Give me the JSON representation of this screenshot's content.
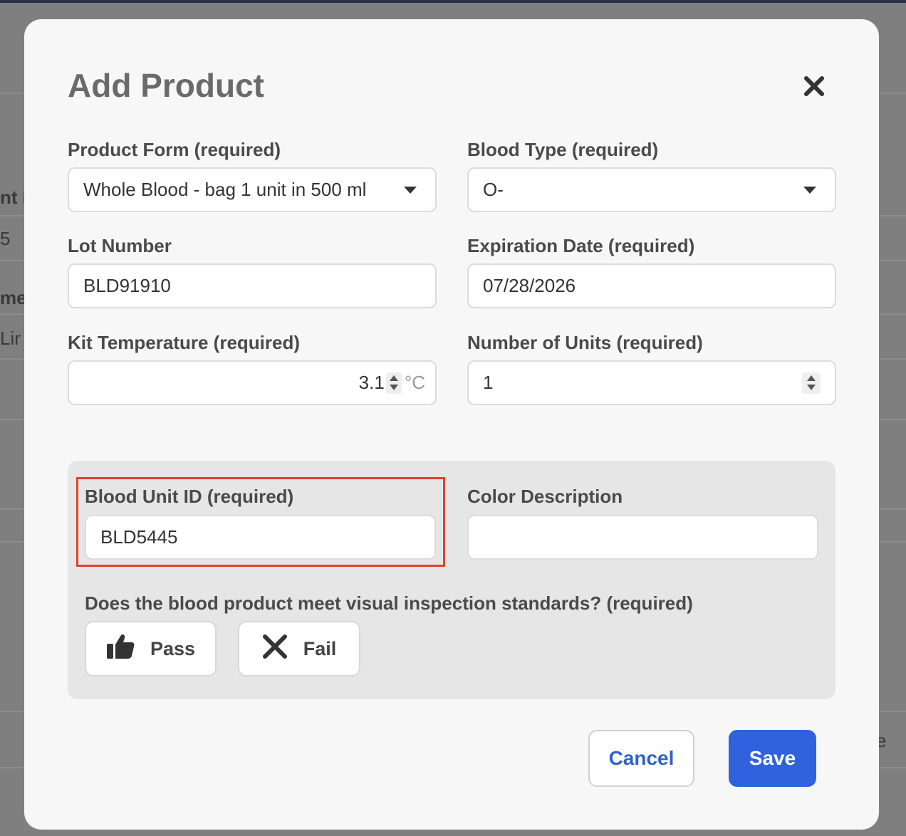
{
  "background": {
    "fragments": [
      "nt I",
      "5",
      "me",
      " Lir",
      "e"
    ]
  },
  "dialog": {
    "title": "Add Product",
    "close_icon": "close-icon"
  },
  "form": {
    "product_form": {
      "label": "Product Form (required)",
      "value": "Whole Blood - bag 1 unit in 500 ml"
    },
    "blood_type": {
      "label": "Blood Type (required)",
      "value": "O-"
    },
    "lot_number": {
      "label": "Lot Number",
      "value": "BLD91910"
    },
    "expiration_date": {
      "label": "Expiration Date (required)",
      "value": "07/28/2026"
    },
    "kit_temperature": {
      "label": "Kit Temperature (required)",
      "value": "3.1",
      "unit": "°C"
    },
    "number_of_units": {
      "label": "Number of Units (required)",
      "value": "1"
    }
  },
  "inspection": {
    "blood_unit_id": {
      "label": "Blood Unit ID (required)",
      "value": "BLD5445"
    },
    "color_description": {
      "label": "Color Description",
      "value": ""
    },
    "question": "Does the blood product meet visual inspection standards? (required)",
    "pass_label": "Pass",
    "fail_label": "Fail",
    "highlight_color": "#e2412e"
  },
  "actions": {
    "cancel_label": "Cancel",
    "save_label": "Save",
    "save_color": "#2f62dc"
  }
}
